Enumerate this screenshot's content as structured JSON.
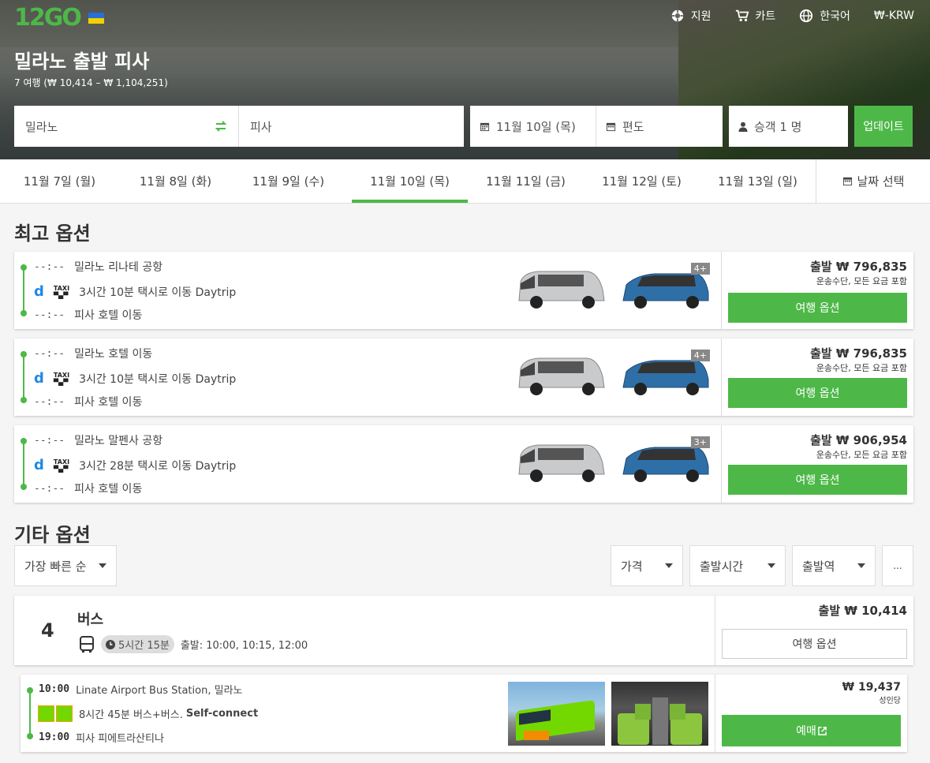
{
  "header": {
    "logo": "12GO",
    "nav": {
      "support": "지원",
      "cart": "카트",
      "language": "한국어",
      "currency": "₩-KRW"
    },
    "title": "밀라노 출발 피사",
    "subtitle": "7 여행 (₩ 10,414 – ₩ 1,104,251)"
  },
  "search": {
    "from": "밀라노",
    "to": "피사",
    "date": "11월 10일 (목)",
    "return": "편도",
    "passengers": "승객 1 명",
    "update": "업데이트"
  },
  "dates": [
    "11월 7일 (월)",
    "11월 8일 (화)",
    "11월 9일 (수)",
    "11월 10일 (목)",
    "11월 11일 (금)",
    "11월 12일 (토)",
    "11월 13일 (일)"
  ],
  "date_picker": "날짜 선택",
  "best_title": "최고 옵션",
  "best": [
    {
      "time": "--:--",
      "from": "밀라노 리나테 공항",
      "trip": "3시간 10분 택시로 이동 Daytrip",
      "to_time": "--:--",
      "to": "피사 호텔 이동",
      "seats": "4+",
      "price": "출발 ₩ 796,835",
      "note": "운송수단, 모든 요금 포함",
      "button": "여행 옵션"
    },
    {
      "time": "--:--",
      "from": "밀라노 호텔 이동",
      "trip": "3시간 10분 택시로 이동 Daytrip",
      "to_time": "--:--",
      "to": "피사 호텔 이동",
      "seats": "4+",
      "price": "출발 ₩ 796,835",
      "note": "운송수단, 모든 요금 포함",
      "button": "여행 옵션"
    },
    {
      "time": "--:--",
      "from": "밀라노 말펜사 공항",
      "trip": "3시간 28분 택시로 이동 Daytrip",
      "to_time": "--:--",
      "to": "피사 호텔 이동",
      "seats": "3+",
      "price": "출발 ₩ 906,954",
      "note": "운송수단, 모든 요금 포함",
      "button": "여행 옵션"
    }
  ],
  "other_title": "기타 옵션",
  "filters": {
    "sort": "가장 빠른 순",
    "price": "가격",
    "departure_time": "출발시간",
    "station": "출발역",
    "more": "..."
  },
  "bus_group": {
    "count": "4",
    "label": "버스",
    "duration": "5시간 15분",
    "departures": "출발: 10:00, 10:15, 12:00",
    "price": "출발 ₩ 10,414",
    "button": "여행 옵션"
  },
  "bus_trip": {
    "dep_time": "10:00",
    "from": "Linate Airport Bus Station, 밀라노",
    "trip": "8시간 45분 버스+버스.",
    "trip_bold": "Self-connect",
    "arr_time": "19:00",
    "to": "피사 피에트라산티나",
    "price": "₩ 19,437",
    "per": "성인당",
    "button": "예매"
  },
  "colors": {
    "accent": "#4db848"
  }
}
